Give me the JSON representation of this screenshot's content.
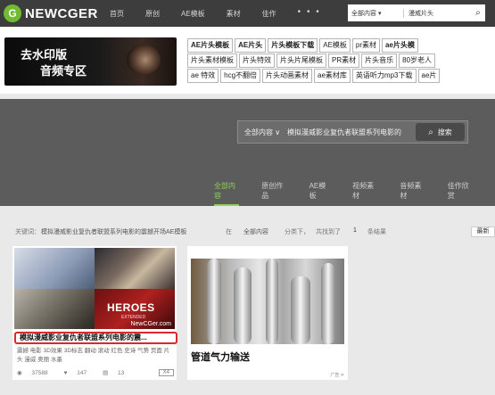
{
  "topbar": {
    "logo_glyph": "G",
    "logo_text": "NEWCGER",
    "nav": [
      "首页",
      "原创",
      "AE模板",
      "素材",
      "佳作"
    ],
    "more": "• • •",
    "search_category": "全部内容 ▾",
    "search_value": "漫威片头"
  },
  "banner": {
    "ad_line1": "去水印版",
    "ad_line2": "音频专区",
    "tag_rows": [
      [
        "AE片头模板",
        "AE片头",
        "片头模板下载",
        "AE模板",
        "pr素材",
        "ae片头模"
      ],
      [
        "片头素材模板",
        "片头特效",
        "片头片尾模板",
        "PR素材",
        "片头音乐",
        "80岁老人"
      ],
      [
        "ae 特效",
        "hcg不翻倍",
        "片头动画素材",
        "ae素材库",
        "英语听力mp3下载",
        "ae片"
      ]
    ]
  },
  "main_search": {
    "category": "全部内容 ∨",
    "value": "模拟漫威影业复仇者联盟系列电影的",
    "button": "搜索"
  },
  "tabs": [
    "全部内容",
    "原创作品",
    "AE模板",
    "视频素材",
    "音频素材",
    "佳作欣赏"
  ],
  "results": {
    "keyword_label": "关键词：",
    "keyword": "模拟漫威影业复仇者联盟系列电影的震撼开场AE模板",
    "in": "在",
    "scope": "全部内容",
    "classify": "分类下，",
    "found": "共找到了",
    "count": "1",
    "suffix": "条结果",
    "sort_button": "最新"
  },
  "card1": {
    "heroes": "HEROES",
    "heroes_sub": "EXTENDED",
    "watermark": "NewCGer.com",
    "title": "模拟漫威影业复仇者联盟系列电影的震...",
    "keywords": "震撼 电影 3D效果 3D标志 翻动 滚动 红色 史诗 气势 页面 片头 漫威 奥丽 水墨",
    "views": "37588",
    "likes": "147",
    "comments": "13",
    "ratio": "X4"
  },
  "card2": {
    "title": "管道气力输送",
    "ad_mark": "广告 ✕"
  }
}
